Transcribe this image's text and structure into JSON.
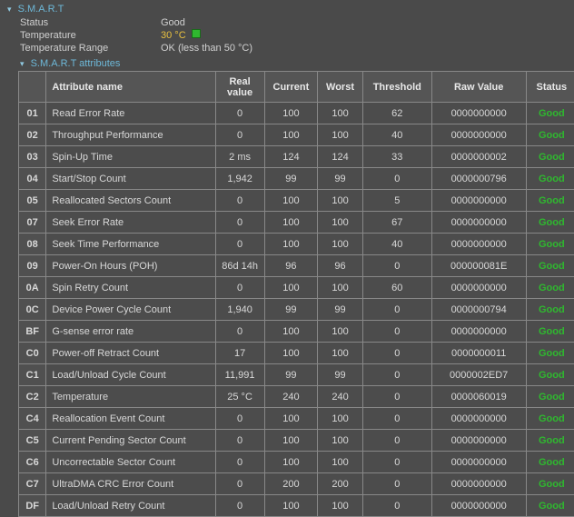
{
  "smart": {
    "title": "S.M.A.R.T",
    "summary": {
      "status_label": "Status",
      "status_value": "Good",
      "temp_label": "Temperature",
      "temp_value": "30 °C",
      "range_label": "Temperature Range",
      "range_value": "OK (less than 50 °C)"
    },
    "attributes_title": "S.M.A.R.T attributes",
    "headers": {
      "id": "",
      "name": "Attribute name",
      "real": "Real value",
      "current": "Current",
      "worst": "Worst",
      "threshold": "Threshold",
      "raw": "Raw Value",
      "status": "Status"
    },
    "rows": [
      {
        "id": "01",
        "name": "Read Error Rate",
        "real": "0",
        "current": "100",
        "worst": "100",
        "threshold": "62",
        "raw": "0000000000",
        "status": "Good"
      },
      {
        "id": "02",
        "name": "Throughput Performance",
        "real": "0",
        "current": "100",
        "worst": "100",
        "threshold": "40",
        "raw": "0000000000",
        "status": "Good"
      },
      {
        "id": "03",
        "name": "Spin-Up Time",
        "real": "2 ms",
        "current": "124",
        "worst": "124",
        "threshold": "33",
        "raw": "0000000002",
        "status": "Good"
      },
      {
        "id": "04",
        "name": "Start/Stop Count",
        "real": "1,942",
        "current": "99",
        "worst": "99",
        "threshold": "0",
        "raw": "0000000796",
        "status": "Good"
      },
      {
        "id": "05",
        "name": "Reallocated Sectors Count",
        "real": "0",
        "current": "100",
        "worst": "100",
        "threshold": "5",
        "raw": "0000000000",
        "status": "Good"
      },
      {
        "id": "07",
        "name": "Seek Error Rate",
        "real": "0",
        "current": "100",
        "worst": "100",
        "threshold": "67",
        "raw": "0000000000",
        "status": "Good"
      },
      {
        "id": "08",
        "name": "Seek Time Performance",
        "real": "0",
        "current": "100",
        "worst": "100",
        "threshold": "40",
        "raw": "0000000000",
        "status": "Good"
      },
      {
        "id": "09",
        "name": "Power-On Hours (POH)",
        "real": "86d 14h",
        "current": "96",
        "worst": "96",
        "threshold": "0",
        "raw": "000000081E",
        "status": "Good"
      },
      {
        "id": "0A",
        "name": "Spin Retry Count",
        "real": "0",
        "current": "100",
        "worst": "100",
        "threshold": "60",
        "raw": "0000000000",
        "status": "Good"
      },
      {
        "id": "0C",
        "name": "Device Power Cycle Count",
        "real": "1,940",
        "current": "99",
        "worst": "99",
        "threshold": "0",
        "raw": "0000000794",
        "status": "Good"
      },
      {
        "id": "BF",
        "name": "G-sense error rate",
        "real": "0",
        "current": "100",
        "worst": "100",
        "threshold": "0",
        "raw": "0000000000",
        "status": "Good"
      },
      {
        "id": "C0",
        "name": "Power-off Retract Count",
        "real": "17",
        "current": "100",
        "worst": "100",
        "threshold": "0",
        "raw": "0000000011",
        "status": "Good"
      },
      {
        "id": "C1",
        "name": "Load/Unload Cycle Count",
        "real": "11,991",
        "current": "99",
        "worst": "99",
        "threshold": "0",
        "raw": "0000002ED7",
        "status": "Good"
      },
      {
        "id": "C2",
        "name": "Temperature",
        "real": "25 °C",
        "current": "240",
        "worst": "240",
        "threshold": "0",
        "raw": "0000060019",
        "status": "Good"
      },
      {
        "id": "C4",
        "name": "Reallocation Event Count",
        "real": "0",
        "current": "100",
        "worst": "100",
        "threshold": "0",
        "raw": "0000000000",
        "status": "Good"
      },
      {
        "id": "C5",
        "name": "Current Pending Sector Count",
        "real": "0",
        "current": "100",
        "worst": "100",
        "threshold": "0",
        "raw": "0000000000",
        "status": "Good"
      },
      {
        "id": "C6",
        "name": "Uncorrectable Sector Count",
        "real": "0",
        "current": "100",
        "worst": "100",
        "threshold": "0",
        "raw": "0000000000",
        "status": "Good"
      },
      {
        "id": "C7",
        "name": "UltraDMA CRC Error Count",
        "real": "0",
        "current": "200",
        "worst": "200",
        "threshold": "0",
        "raw": "0000000000",
        "status": "Good"
      },
      {
        "id": "DF",
        "name": "Load/Unload Retry Count",
        "real": "0",
        "current": "100",
        "worst": "100",
        "threshold": "0",
        "raw": "0000000000",
        "status": "Good"
      }
    ]
  }
}
